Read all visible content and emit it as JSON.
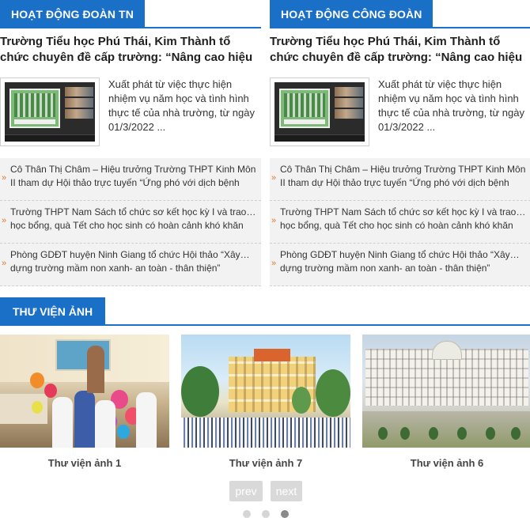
{
  "sections": [
    {
      "title": "HOẠT ĐỘNG ĐOÀN TN",
      "feature": {
        "title": "Trường Tiểu học Phú Thái, Kim Thành tổ chức chuyên đề cấp trường: “Nâng cao hiệu quả dạy",
        "excerpt": "Xuất phát từ việc thực hiện nhiệm vụ năm học và tình hình thực tế của nhà trường, từ ngày 01/3/2022 ..."
      },
      "news": [
        {
          "line1": "Cô Thân Thị Châm – Hiệu trưởng Trường THPT Kinh Môn",
          "line2": "II tham dự Hội thảo trực tuyến “Ứng phó với dịch bệnh"
        },
        {
          "line1": "Trường THPT Nam Sách tổ chức sơ kết học kỳ I và trao…",
          "line2": "học bổng, quà Tết cho học sinh có hoàn cảnh khó khăn"
        },
        {
          "line1": "Phòng GDĐT huyện Ninh Giang tổ chức Hội thảo “Xây…",
          "line2": "dựng trường mầm non xanh- an toàn - thân thiện”"
        }
      ]
    },
    {
      "title": "HOẠT ĐỘNG CÔNG ĐOÀN",
      "feature": {
        "title": "Trường Tiểu học Phú Thái, Kim Thành tổ chức chuyên đề cấp trường: “Nâng cao hiệu quả dạy",
        "excerpt": "Xuất phát từ việc thực hiện nhiệm vụ năm học và tình hình thực tế của nhà trường, từ ngày 01/3/2022 ..."
      },
      "news": [
        {
          "line1": "Cô Thân Thị Châm – Hiệu trưởng Trường THPT Kinh Môn",
          "line2": "II tham dự Hội thảo trực tuyến “Ứng phó với dịch bệnh"
        },
        {
          "line1": "Trường THPT Nam Sách tổ chức sơ kết học kỳ I và trao…",
          "line2": "học bổng, quà Tết cho học sinh có hoàn cảnh khó khăn"
        },
        {
          "line1": "Phòng GDĐT huyện Ninh Giang tổ chức Hội thảo “Xây…",
          "line2": "dựng trường mầm non xanh- an toàn - thân thiện”"
        }
      ]
    }
  ],
  "gallery": {
    "title": "THƯ VIỆN ẢNH",
    "items": [
      {
        "caption": "Thư viện ảnh 1"
      },
      {
        "caption": "Thư viện ảnh 7"
      },
      {
        "caption": "Thư viện ảnh 6"
      }
    ],
    "prev_label": "prev",
    "next_label": "next",
    "active_dot": 3,
    "dot_count": 3
  },
  "colors": {
    "accent": "#1a6fc7",
    "bullet": "#e07a2e",
    "list_bg": "#f2f2f2"
  }
}
